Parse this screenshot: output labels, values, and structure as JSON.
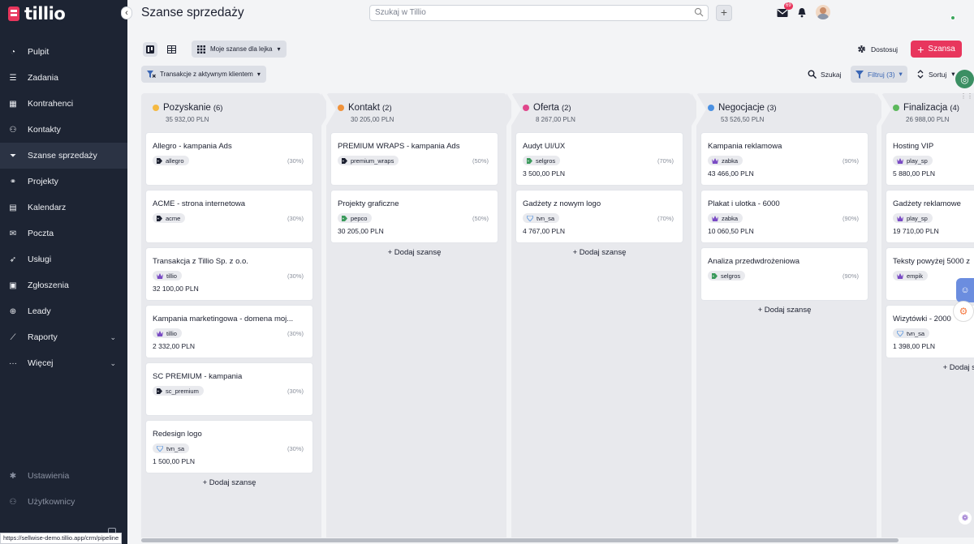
{
  "app": {
    "brand": "tillio"
  },
  "sidebar": {
    "items": [
      {
        "label": "Pulpit",
        "icon": "gauge-icon",
        "active": false
      },
      {
        "label": "Zadania",
        "icon": "task-list-icon",
        "active": false
      },
      {
        "label": "Kontrahenci",
        "icon": "building-icon",
        "active": false
      },
      {
        "label": "Kontakty",
        "icon": "contacts-icon",
        "active": false
      },
      {
        "label": "Szanse sprzedaży",
        "icon": "funnel-icon",
        "active": true
      },
      {
        "label": "Projekty",
        "icon": "projects-icon",
        "active": false
      },
      {
        "label": "Kalendarz",
        "icon": "calendar-icon",
        "active": false
      },
      {
        "label": "Poczta",
        "icon": "mail-icon",
        "active": false
      },
      {
        "label": "Usługi",
        "icon": "rocket-icon",
        "active": false
      },
      {
        "label": "Zgłoszenia",
        "icon": "clipboard-icon",
        "active": false
      },
      {
        "label": "Leady",
        "icon": "crosshair-icon",
        "active": false
      },
      {
        "label": "Raporty",
        "icon": "chart-line-icon",
        "active": false,
        "expandable": true
      },
      {
        "label": "Więcej",
        "icon": "more-icon",
        "active": false,
        "expandable": true
      }
    ],
    "bottom": [
      {
        "label": "Ustawienia",
        "icon": "gear-icon"
      },
      {
        "label": "Użytkownicy",
        "icon": "users-icon"
      }
    ]
  },
  "header": {
    "title": "Szanse sprzedaży",
    "search_placeholder": "Szukaj w Tillio",
    "notifications_count": "69"
  },
  "toolbar": {
    "funnel_label": "Moje szanse dla lejka",
    "filter_chip_label": "Transakcje z aktywnym klientem",
    "customize_label": "Dostosuj",
    "add_deal_label": "Szansa",
    "search_label": "Szukaj",
    "filter_label": "Filtruj (3)",
    "sort_label": "Sortuj"
  },
  "board": {
    "add_label": "+ Dodaj szansę",
    "columns": [
      {
        "name": "Pozyskanie",
        "count": "(6)",
        "sum": "35 932,00 PLN",
        "color": "#f5b942",
        "cards": [
          {
            "title": "Allegro - kampania Ads",
            "tag": "allegro",
            "tag_icon": "tag",
            "prob": "(30%)",
            "amount": ""
          },
          {
            "title": "ACME - strona internetowa",
            "tag": "acme",
            "tag_icon": "tag",
            "prob": "(30%)",
            "amount": ""
          },
          {
            "title": "Transakcja z Tillio Sp. z o.o.",
            "tag": "tillio",
            "tag_icon": "crown",
            "prob": "(30%)",
            "amount": "32 100,00 PLN"
          },
          {
            "title": "Kampania marketingowa - domena moj...",
            "tag": "tillio",
            "tag_icon": "crown",
            "prob": "(30%)",
            "amount": "2 332,00 PLN"
          },
          {
            "title": "SC PREMIUM - kampania",
            "tag": "sc_premium",
            "tag_icon": "tag",
            "prob": "(30%)",
            "amount": ""
          },
          {
            "title": "Redesign logo",
            "tag": "tvn_sa",
            "tag_icon": "diamond",
            "prob": "(30%)",
            "amount": "1 500,00 PLN"
          }
        ]
      },
      {
        "name": "Kontakt",
        "count": "(2)",
        "sum": "30 205,00 PLN",
        "color": "#f0923a",
        "cards": [
          {
            "title": "PREMIUM WRAPS - kampania Ads",
            "tag": "premium_wraps",
            "tag_icon": "tag",
            "prob": "(50%)",
            "amount": ""
          },
          {
            "title": "Projekty graficzne",
            "tag": "pepco",
            "tag_icon": "tag-green",
            "prob": "(50%)",
            "amount": "30 205,00 PLN"
          }
        ]
      },
      {
        "name": "Oferta",
        "count": "(2)",
        "sum": "8 267,00 PLN",
        "color": "#e0468b",
        "cards": [
          {
            "title": "Audyt UI/UX",
            "tag": "selgros",
            "tag_icon": "tag-green",
            "prob": "(70%)",
            "amount": "3 500,00 PLN"
          },
          {
            "title": "Gadżety z nowym logo",
            "tag": "tvn_sa",
            "tag_icon": "diamond",
            "prob": "(70%)",
            "amount": "4 767,00 PLN"
          }
        ]
      },
      {
        "name": "Negocjacje",
        "count": "(3)",
        "sum": "53 526,50 PLN",
        "color": "#4a90e2",
        "cards": [
          {
            "title": "Kampania reklamowa",
            "tag": "zabka",
            "tag_icon": "crown",
            "prob": "(90%)",
            "amount": "43 466,00 PLN"
          },
          {
            "title": "Plakat i ulotka - 6000",
            "tag": "zabka",
            "tag_icon": "crown",
            "prob": "(90%)",
            "amount": "10 060,50 PLN"
          },
          {
            "title": "Analiza przedwdrożeniowa",
            "tag": "selgros",
            "tag_icon": "tag-green",
            "prob": "(90%)",
            "amount": ""
          }
        ]
      },
      {
        "name": "Finalizacja",
        "count": "(4)",
        "sum": "26 988,00 PLN",
        "color": "#5cb85c",
        "cards": [
          {
            "title": "Hosting VIP",
            "tag": "play_sp",
            "tag_icon": "crown",
            "prob": "",
            "amount": "5 880,00 PLN"
          },
          {
            "title": "Gadżety reklamowe",
            "tag": "play_sp",
            "tag_icon": "crown",
            "prob": "",
            "amount": "19 710,00 PLN"
          },
          {
            "title": "Teksty powyżej 5000 z",
            "tag": "empik",
            "tag_icon": "crown",
            "prob": "",
            "amount": ""
          },
          {
            "title": "Wizytówki - 2000",
            "tag": "tvn_sa",
            "tag_icon": "diamond",
            "prob": "",
            "amount": "1 398,00 PLN"
          }
        ]
      }
    ]
  },
  "statusbar": {
    "url": "https://sellwise-demo.tillio.app/crm/pipeline"
  }
}
